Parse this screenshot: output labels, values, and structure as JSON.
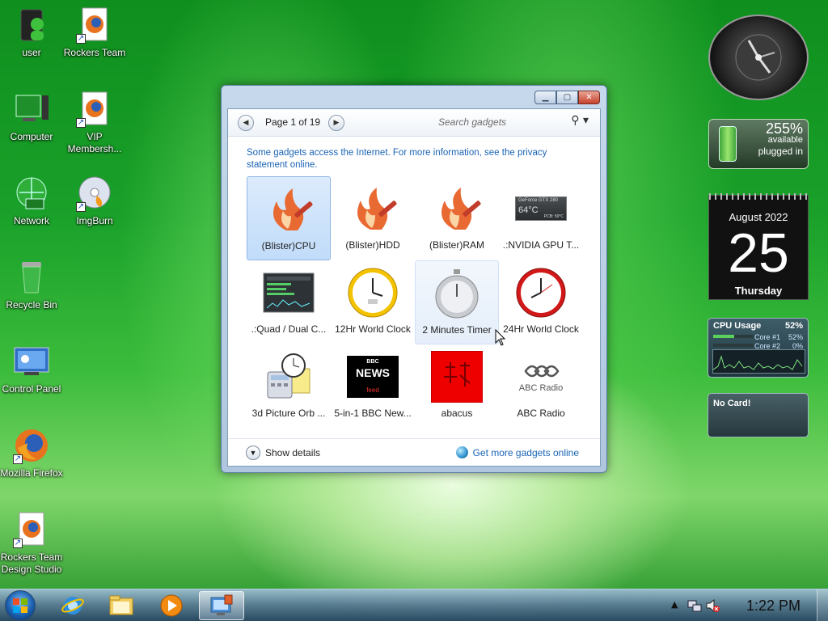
{
  "desktop": {
    "icons": [
      {
        "label": "user"
      },
      {
        "label": "Rockers Team"
      },
      {
        "label": "Computer"
      },
      {
        "label": "VIP Membersh..."
      },
      {
        "label": "Network"
      },
      {
        "label": "ImgBurn"
      },
      {
        "label": "Recycle Bin"
      },
      {
        "label": "Control Panel"
      },
      {
        "label": "Mozilla Firefox"
      },
      {
        "label": "Rockers Team Design Studio"
      }
    ]
  },
  "gadget_window": {
    "page_label": "Page 1 of 19",
    "search_placeholder": "Search gadgets",
    "info_text": "Some gadgets access the Internet.  For more information, see the privacy statement online.",
    "gadgets": [
      {
        "label": "(Blister)CPU"
      },
      {
        "label": "(Blister)HDD"
      },
      {
        "label": "(Blister)RAM"
      },
      {
        "label": ".:NVIDIA GPU T..."
      },
      {
        "label": ".:Quad / Dual C..."
      },
      {
        "label": "12Hr World Clock"
      },
      {
        "label": "2 Minutes Timer"
      },
      {
        "label": "24Hr World Clock"
      },
      {
        "label": "3d Picture Orb ..."
      },
      {
        "label": "5-in-1 BBC New..."
      },
      {
        "label": "abacus"
      },
      {
        "label": "ABC Radio"
      }
    ],
    "nvidia_thumb": {
      "line1": "GeForce GTX 280",
      "temp": "64°C",
      "pcb": "PCB: 59°C"
    },
    "bbc_thumb": {
      "brand": "BBC",
      "title": "NEWS",
      "feed": "feed"
    },
    "abc_thumb": {
      "text": "ABC Radio"
    },
    "show_details": "Show details",
    "get_more": "Get more gadgets online"
  },
  "sidebar": {
    "battery": {
      "percent": "255%",
      "available": "available",
      "status": "plugged in"
    },
    "calendar": {
      "month": "August 2022",
      "day": "25",
      "weekday": "Thursday"
    },
    "cpu": {
      "title": "CPU Usage",
      "value": "52%",
      "core1_label": "Core #1",
      "core1_value": "52%",
      "core2_label": "Core #2",
      "core2_value": "0%",
      "core1_level": 0.52,
      "core2_level": 0.0
    },
    "gpu": {
      "text": "No Card!"
    }
  },
  "taskbar": {
    "time": "1:22 PM"
  },
  "colors": {
    "link": "#1a64b4",
    "accent_green": "#1aa12a"
  }
}
